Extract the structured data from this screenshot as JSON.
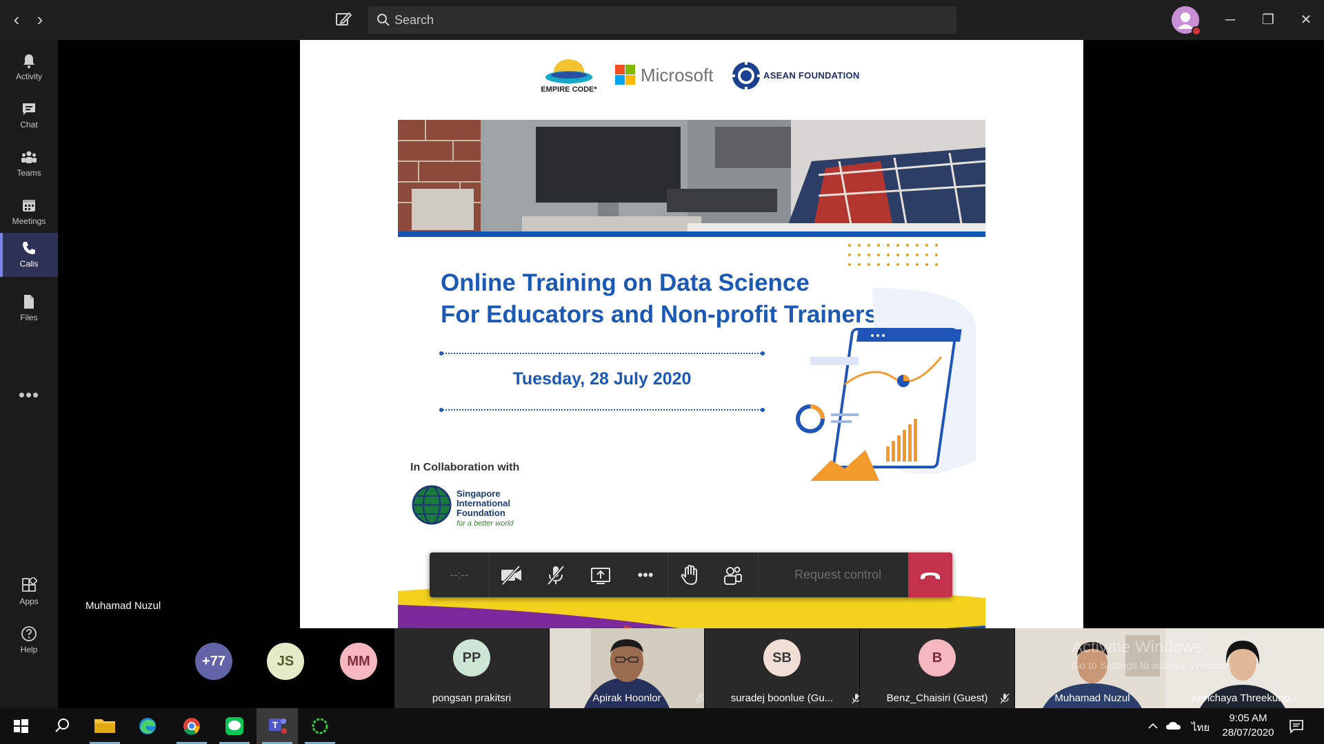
{
  "titlebar": {
    "search_placeholder": "Search",
    "back_icon": "chevron-left-icon",
    "forward_icon": "chevron-right-icon",
    "min_icon": "─",
    "restore_icon": "❐",
    "close_icon": "✕"
  },
  "rail": {
    "items": [
      {
        "label": "Activity",
        "icon": "bell-icon"
      },
      {
        "label": "Chat",
        "icon": "chat-icon"
      },
      {
        "label": "Teams",
        "icon": "teams-icon"
      },
      {
        "label": "Meetings",
        "icon": "calendar-icon"
      },
      {
        "label": "Calls",
        "icon": "phone-icon",
        "active": true
      },
      {
        "label": "Files",
        "icon": "file-icon"
      }
    ],
    "more": "•••",
    "bottom": [
      {
        "label": "Apps",
        "icon": "apps-icon"
      },
      {
        "label": "Help",
        "icon": "help-icon"
      }
    ]
  },
  "slide": {
    "logo_empire": "EMPIRE CODE*",
    "logo_microsoft": "Microsoft",
    "logo_asean": "ASEAN FOUNDATION",
    "headline_line1": "Online Training on Data Science",
    "headline_line2": "For Educators and Non-profit Trainers",
    "date": "Tuesday, 28 July 2020",
    "collab": "In Collaboration with",
    "sif_line1": "Singapore",
    "sif_line2": "International",
    "sif_line3": "Foundation",
    "sif_tagline": "for a better world"
  },
  "presenter_name": "Muhamad Nuzul",
  "controls": {
    "timer": "--:--",
    "request_control": "Request control",
    "more": "•••"
  },
  "participants": {
    "overflow": "+77",
    "bubbles": [
      {
        "initials": "JS",
        "color": "#e6ebc7",
        "text": "#4d5a2c"
      },
      {
        "initials": "MM",
        "color": "#f5b7c0",
        "text": "#7a2b38"
      }
    ],
    "tiles": [
      {
        "name": "pongsan prakitsri",
        "initials": "PP",
        "color": "#cde5d4",
        "type": "avatar"
      },
      {
        "name": "Apirak Hoonlor",
        "type": "video"
      },
      {
        "name": "suradej boonlue (Gu...",
        "initials": "SB",
        "color": "#f1dfd6",
        "type": "avatar"
      },
      {
        "name": "Benz_Chaisiri (Guest)",
        "initials": "B",
        "color": "#f5b7c0",
        "type": "avatar"
      },
      {
        "name": "Muhamad Nuzul",
        "type": "video"
      },
      {
        "name": "Arinchaya Threekunp...",
        "type": "video"
      }
    ]
  },
  "watermark": {
    "line1": "Activate Windows",
    "line2": "Go to Settings to activate Windows."
  },
  "taskbar": {
    "time": "9:05 AM",
    "date": "28/07/2020",
    "lang": "ไทย"
  },
  "colors": {
    "accent": "#7b83eb",
    "hangup": "#c4314b",
    "slide_blue": "#1c59b5"
  }
}
